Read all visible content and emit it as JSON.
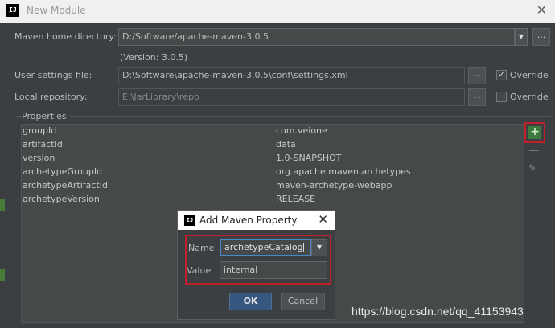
{
  "window": {
    "title": "New Module",
    "logo_text": "IJ"
  },
  "maven": {
    "home_label": "Maven home directory:",
    "home_value": "D:/Software/apache-maven-3.0.5",
    "version_note": "(Version: 3.0.5)",
    "settings_label": "User settings file:",
    "settings_value": "D:\\Software\\apache-maven-3.0.5\\conf\\settings.xml",
    "settings_override_label": "Override",
    "settings_override_checked": true,
    "repo_label": "Local repository:",
    "repo_value": "E:\\JarLibrary\\repo",
    "repo_override_label": "Override",
    "repo_override_checked": false,
    "browse_label": "..."
  },
  "properties": {
    "group_title": "Properties",
    "rows": [
      {
        "key": "groupId",
        "value": "com.veione"
      },
      {
        "key": "artifactId",
        "value": "data"
      },
      {
        "key": "version",
        "value": "1.0-SNAPSHOT"
      },
      {
        "key": "archetypeGroupId",
        "value": "org.apache.maven.archetypes"
      },
      {
        "key": "archetypeArtifactId",
        "value": "maven-archetype-webapp"
      },
      {
        "key": "archetypeVersion",
        "value": "RELEASE"
      }
    ],
    "add_icon": "plus-icon",
    "remove_icon": "minus-icon",
    "edit_icon": "pencil-icon"
  },
  "dialog": {
    "title": "Add Maven Property",
    "name_label": "Name",
    "name_value": "archetypeCatalog",
    "value_label": "Value",
    "value_value": "internal",
    "ok_label": "OK",
    "cancel_label": "Cancel"
  },
  "watermark": "https://blog.csdn.net/qq_41153943",
  "colors": {
    "highlight_border": "#c0202a",
    "ok_button": "#365880",
    "add_button": "#3e7a3e"
  }
}
